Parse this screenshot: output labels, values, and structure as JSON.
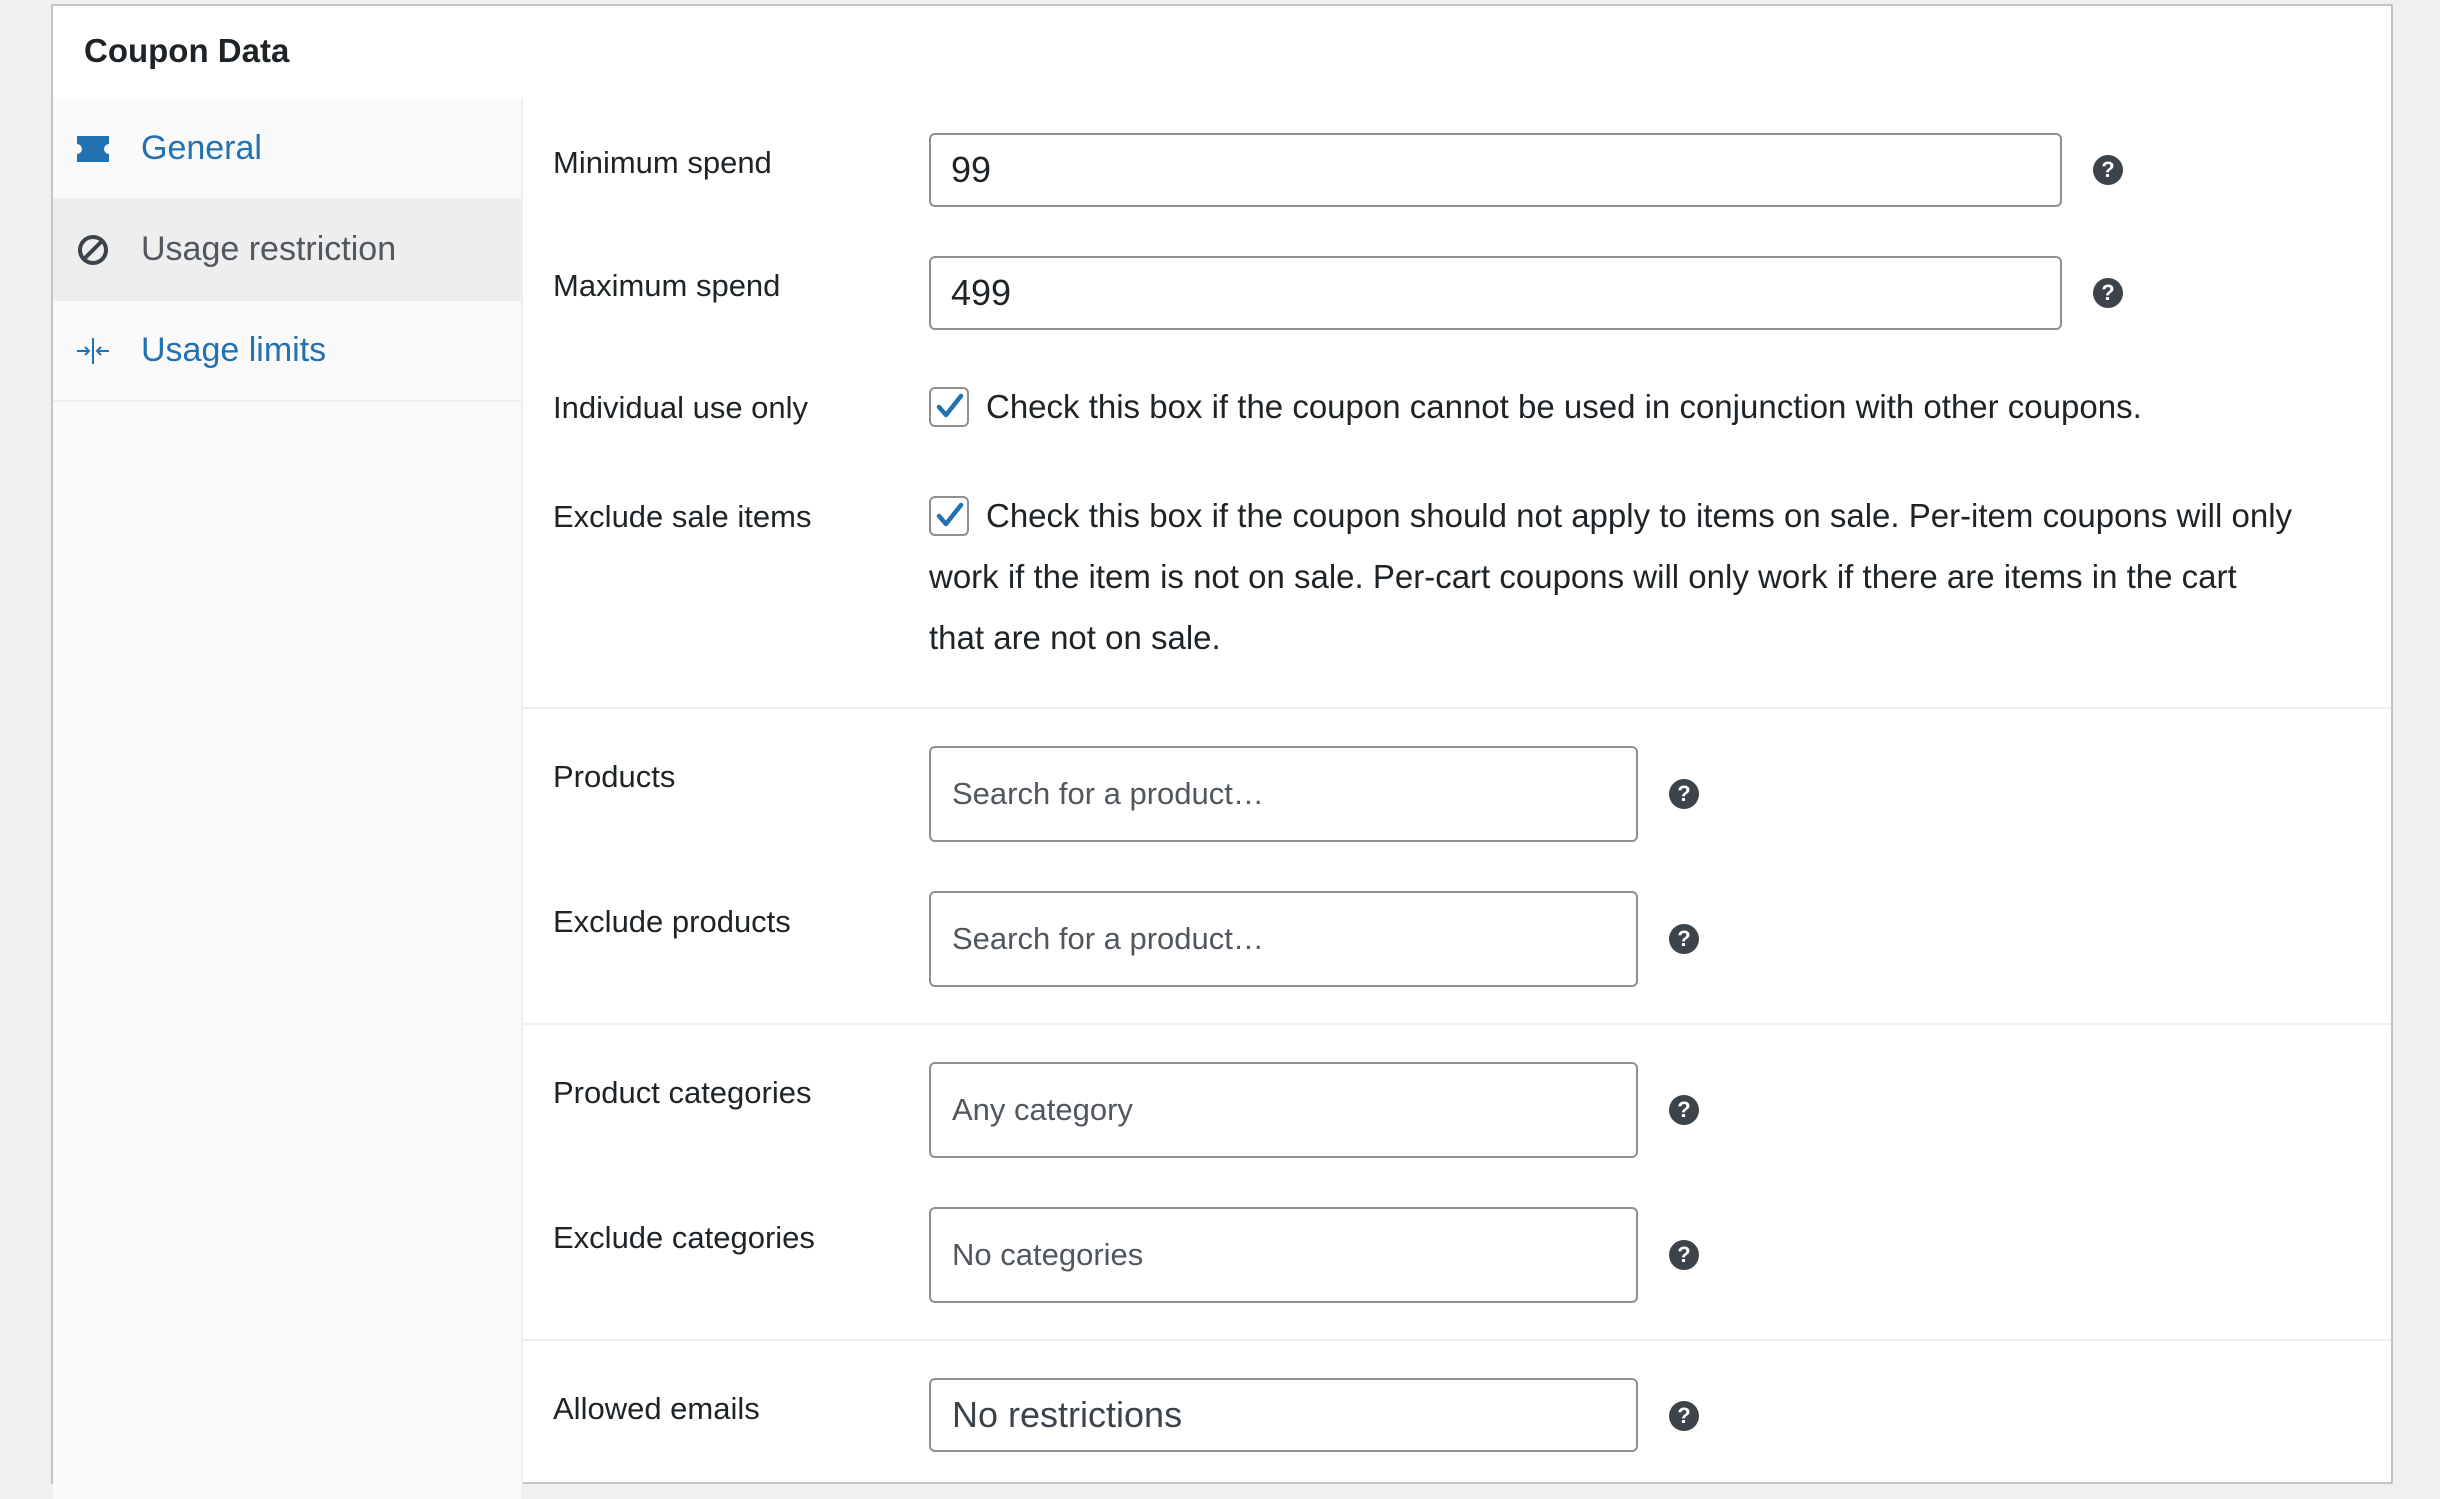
{
  "panel": {
    "title": "Coupon Data"
  },
  "tabs": [
    {
      "label": "General",
      "icon": "ticket-icon",
      "active": false
    },
    {
      "label": "Usage restriction",
      "icon": "block-icon",
      "active": true
    },
    {
      "label": "Usage limits",
      "icon": "arrows-in-icon",
      "active": false
    }
  ],
  "fields": {
    "minimum_spend": {
      "label": "Minimum spend",
      "value": "99"
    },
    "maximum_spend": {
      "label": "Maximum spend",
      "value": "499"
    },
    "individual_use": {
      "label": "Individual use only",
      "checked": true,
      "description": "Check this box if the coupon cannot be used in conjunction with other coupons."
    },
    "exclude_sale": {
      "label": "Exclude sale items",
      "checked": true,
      "description_line1": "Check this box if the coupon should not apply to items on sale. Per-item coupons will only",
      "description_line2": "work if the item is not on sale. Per-cart coupons will only work if there are items in the cart",
      "description_line3": "that are not on sale."
    },
    "products": {
      "label": "Products",
      "placeholder": "Search for a product…"
    },
    "exclude_products": {
      "label": "Exclude products",
      "placeholder": "Search for a product…"
    },
    "product_categories": {
      "label": "Product categories",
      "placeholder": "Any category"
    },
    "exclude_categories": {
      "label": "Exclude categories",
      "placeholder": "No categories"
    },
    "allowed_emails": {
      "label": "Allowed emails",
      "placeholder": "No restrictions"
    }
  },
  "help_glyph": "?",
  "colors": {
    "link": "#2271b1",
    "checkmark": "#2271b1",
    "help_bg": "#3c434a"
  }
}
